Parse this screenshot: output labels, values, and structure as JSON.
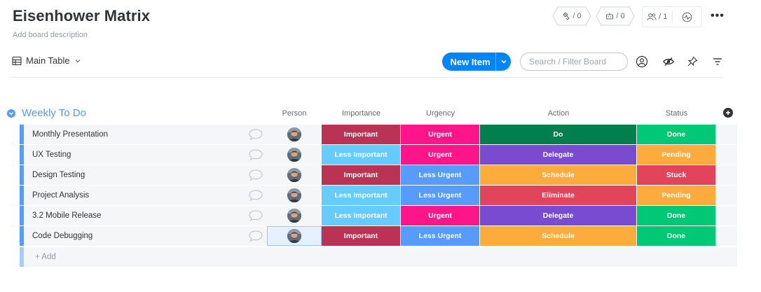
{
  "board": {
    "title": "Eisenhower Matrix",
    "description": "Add board description"
  },
  "header": {
    "integrations_count": "/ 0",
    "automations_count": "/ 0",
    "members_count": "/ 1",
    "more": "•••"
  },
  "toolbar": {
    "view_label": "Main Table",
    "new_item_label": "New Item",
    "search_placeholder": "Search / Filter Board"
  },
  "group": {
    "title": "Weekly To Do",
    "color": "#579bfc",
    "add_label": "+ Add"
  },
  "columns": {
    "person": "Person",
    "importance": "Importance",
    "urgency": "Urgency",
    "action": "Action",
    "status": "Status"
  },
  "colors": {
    "Important": "#bb3354",
    "Less Important": "#66ccff",
    "Urgent": "#ff158a",
    "Less Urgent": "#579bfc",
    "Do": "#037f4c",
    "Delegate": "#784bd1",
    "Schedule": "#fdab3d",
    "Eliminate": "#e2445c",
    "Done": "#00c875",
    "Pending": "#fdab3d",
    "Stuck": "#e2445c"
  },
  "rows": [
    {
      "name": "Monthly Presentation",
      "importance": "Important",
      "urgency": "Urgent",
      "action": "Do",
      "status": "Done"
    },
    {
      "name": "UX Testing",
      "importance": "Less Important",
      "urgency": "Urgent",
      "action": "Delegate",
      "status": "Pending"
    },
    {
      "name": "Design Testing",
      "importance": "Important",
      "urgency": "Less Urgent",
      "action": "Schedule",
      "status": "Stuck"
    },
    {
      "name": "Project Analysis",
      "importance": "Less Important",
      "urgency": "Less Urgent",
      "action": "Eliminate",
      "status": "Pending"
    },
    {
      "name": "3.2 Mobile Release",
      "importance": "Less Important",
      "urgency": "Urgent",
      "action": "Delegate",
      "status": "Done"
    },
    {
      "name": "Code Debugging",
      "importance": "Important",
      "urgency": "Less Urgent",
      "action": "Schedule",
      "status": "Done"
    }
  ]
}
